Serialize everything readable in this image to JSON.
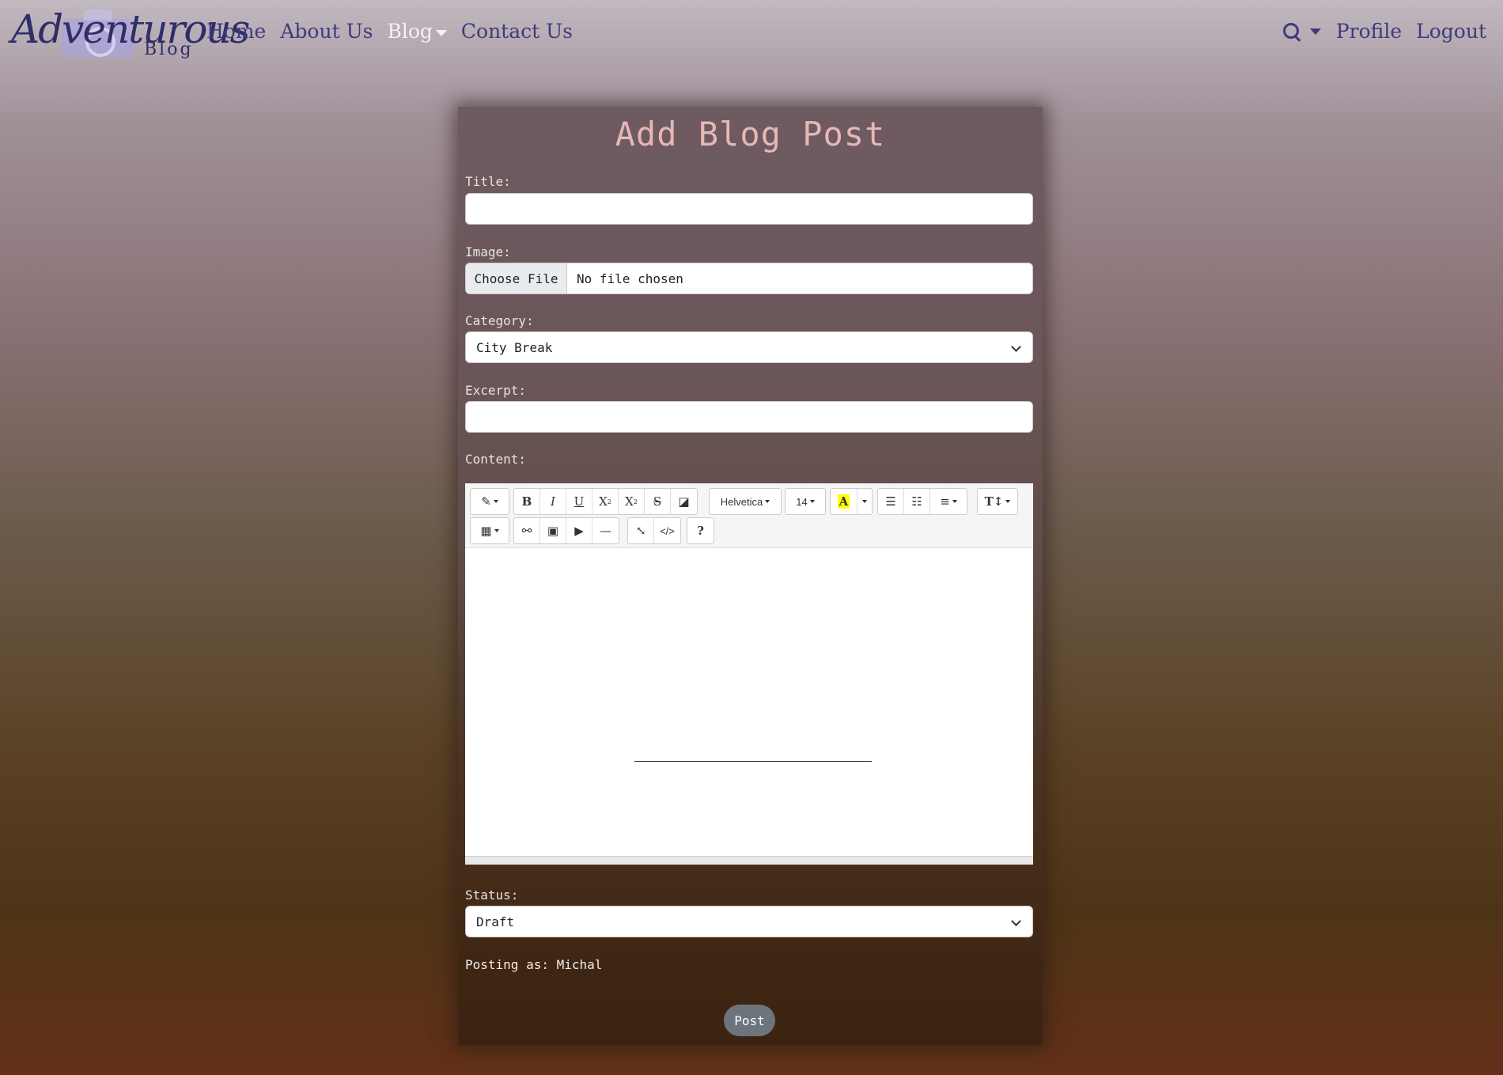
{
  "nav": {
    "logo_text": "Adventurous",
    "logo_sub": "Blog",
    "links": [
      "Home",
      "About Us",
      "Blog",
      "Contact Us"
    ],
    "profile": "Profile",
    "logout": "Logout"
  },
  "form": {
    "title": "Add Blog Post",
    "title_label": "Title:",
    "title_value": "",
    "image_label": "Image:",
    "file_button": "Choose File",
    "file_status": "No file chosen",
    "category_label": "Category:",
    "category_value": "City Break",
    "excerpt_label": "Excerpt:",
    "excerpt_value": "",
    "content_label": "Content:",
    "status_label": "Status:",
    "status_value": "Draft",
    "posting_as": "Posting as: Michal",
    "submit": "Post"
  },
  "editor": {
    "font_name": "Helvetica",
    "font_size": "14",
    "toolbar_row1": [
      "magic-icon",
      "bold-icon",
      "italic-icon",
      "underline-icon",
      "superscript-icon",
      "subscript-icon",
      "strikethrough-icon",
      "eraser-icon",
      "font-family",
      "font-size",
      "color-icon",
      "ul-icon",
      "ol-icon",
      "align-icon",
      "line-height-icon"
    ],
    "toolbar_row2": [
      "table-icon",
      "link-icon",
      "picture-icon",
      "video-icon",
      "hr-icon",
      "fullscreen-icon",
      "codeview-icon",
      "help-icon"
    ]
  },
  "colors": {
    "nav_text": "#3d3c7a",
    "title": "#e5b8b5",
    "post_button": "#6c757d"
  }
}
